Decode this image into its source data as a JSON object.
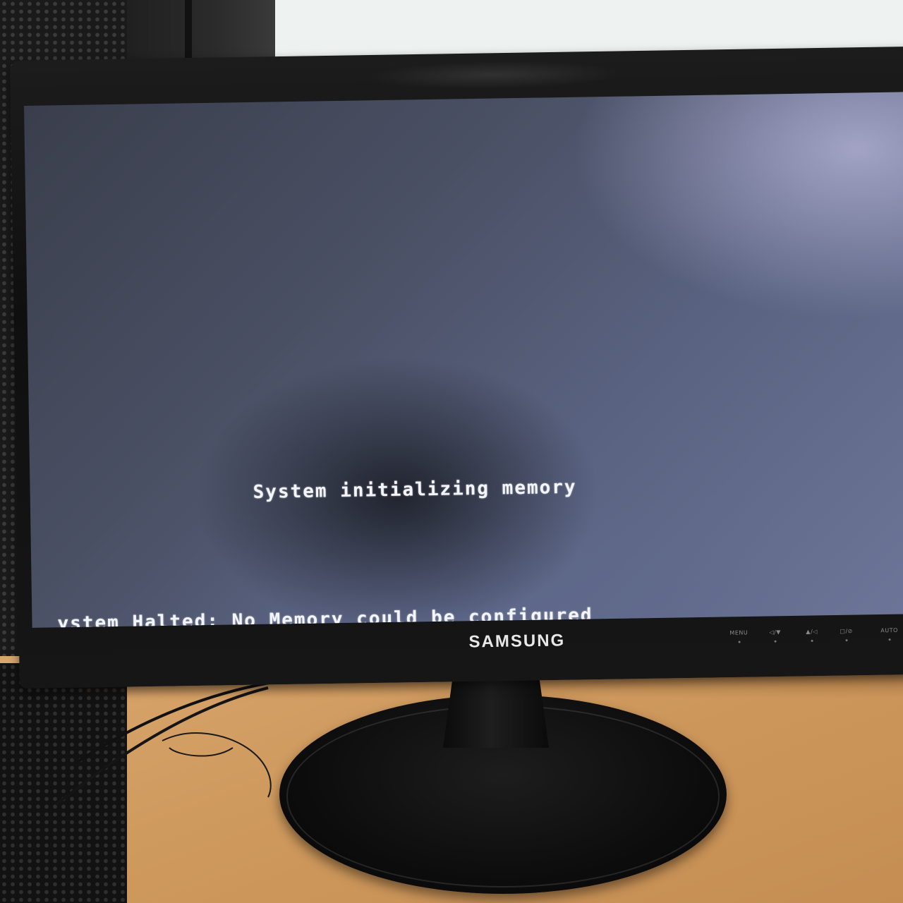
{
  "screen": {
    "line_1": "System initializing memory",
    "line_2": "ystem Halted: No Memory could be configured"
  },
  "monitor": {
    "brand": "SAMSUNG",
    "controls": [
      "MENU",
      "◁/▼",
      "▲/◁",
      "□/⊘",
      "AUTO"
    ]
  },
  "colors": {
    "screen_text": "#f4f5fa",
    "bezel": "#111111",
    "desk": "#cf9a5e"
  }
}
